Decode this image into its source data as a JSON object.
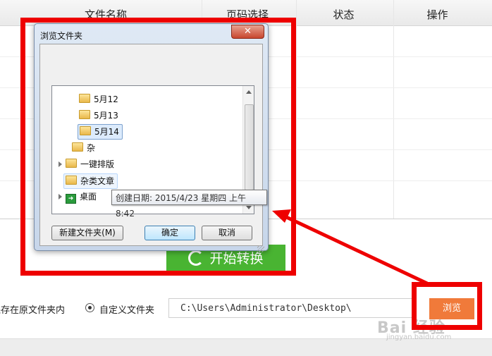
{
  "table": {
    "headers": [
      "文件名称",
      "页码选择",
      "状态",
      "操作"
    ]
  },
  "start_button": {
    "label": "开始转换"
  },
  "save": {
    "original_label": "保存在原文件夹内",
    "custom_label": "自定义文件夹",
    "path": "C:\\Users\\Administrator\\Desktop\\",
    "browse_label": "浏览"
  },
  "dialog": {
    "title": "浏览文件夹",
    "close": "✕",
    "tree": [
      {
        "label": "5月12",
        "kind": "folder"
      },
      {
        "label": "5月13",
        "kind": "folder"
      },
      {
        "label": "5月14",
        "kind": "folder",
        "state": "selected"
      },
      {
        "label": "杂",
        "kind": "folder"
      },
      {
        "label": "一键排版",
        "kind": "folder",
        "expandable": true
      },
      {
        "label": "杂类文章",
        "kind": "folder",
        "state": "hover"
      },
      {
        "label": "桌面",
        "kind": "desktop",
        "expandable": true
      }
    ],
    "tooltip": "创建日期: 2015/4/23 星期四 上午 8:42",
    "new_folder": "新建文件夹(M)",
    "ok": "确定",
    "cancel": "取消"
  },
  "watermark": {
    "text": "Bai 经验",
    "sub": "jingyan.baidu.com"
  },
  "colors": {
    "annotation": "#ee0000",
    "start": "#49b432",
    "browse": "#f07a3a"
  }
}
